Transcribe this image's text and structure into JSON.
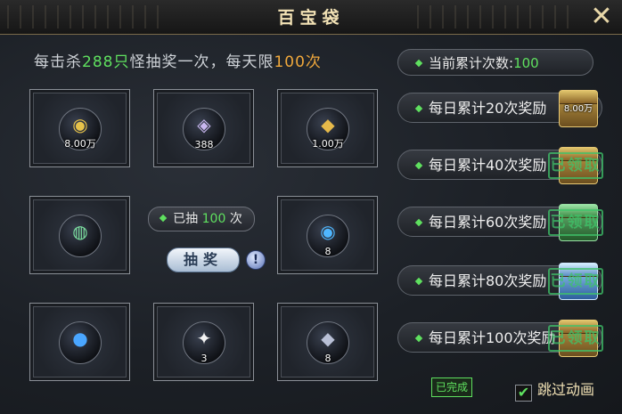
{
  "window": {
    "title": "百宝袋"
  },
  "info": {
    "prefix": "每击杀",
    "kills": "288只",
    "middle": "怪抽奖一次，每天限",
    "limit": "100次"
  },
  "slots": [
    {
      "count": "8.00万",
      "glyph": "◉",
      "color": "#e6c24a"
    },
    {
      "count": "388",
      "glyph": "◈",
      "color": "#c9b7f0"
    },
    {
      "count": "1.00万",
      "glyph": "◆",
      "color": "#e6b94a"
    },
    {
      "count": "",
      "glyph": "◍",
      "color": "#7ce0a0"
    },
    {
      "count": "8",
      "glyph": "◉",
      "color": "#4fb7ff"
    },
    {
      "count": "",
      "glyph": "●",
      "color": "#4aa6ff"
    },
    {
      "count": "3",
      "glyph": "✦",
      "color": "#f2f2f2"
    },
    {
      "count": "8",
      "glyph": "◆",
      "color": "#b9c0d6"
    }
  ],
  "drawn": {
    "label": "已抽",
    "value": "100",
    "unit": "次"
  },
  "draw_button": "抽奖",
  "info_icon": "!",
  "cumulative": {
    "label": "当前累计次数:",
    "value": "100"
  },
  "rewards": [
    {
      "label": "每日累计20次奖励",
      "count": "8.00万",
      "chest": "gold",
      "claimed": false
    },
    {
      "label": "每日累计40次奖励",
      "count": "",
      "chest": "gold",
      "claimed": true,
      "stamp": "已领取"
    },
    {
      "label": "每日累计60次奖励",
      "count": "",
      "chest": "green",
      "claimed": true,
      "stamp": "已领取"
    },
    {
      "label": "每日累计80次奖励",
      "count": "",
      "chest": "blue",
      "claimed": true,
      "stamp": "已领取"
    },
    {
      "label": "每日累计100次奖励",
      "count": "",
      "chest": "gold",
      "claimed": true,
      "stamp": "已领取"
    }
  ],
  "done_label": "已完成",
  "skip_label": "跳过动画",
  "skip_checked": true,
  "colors": {
    "accent_green": "#5fe05f",
    "accent_orange": "#f0a83c",
    "title_gold": "#f2e2b5"
  }
}
